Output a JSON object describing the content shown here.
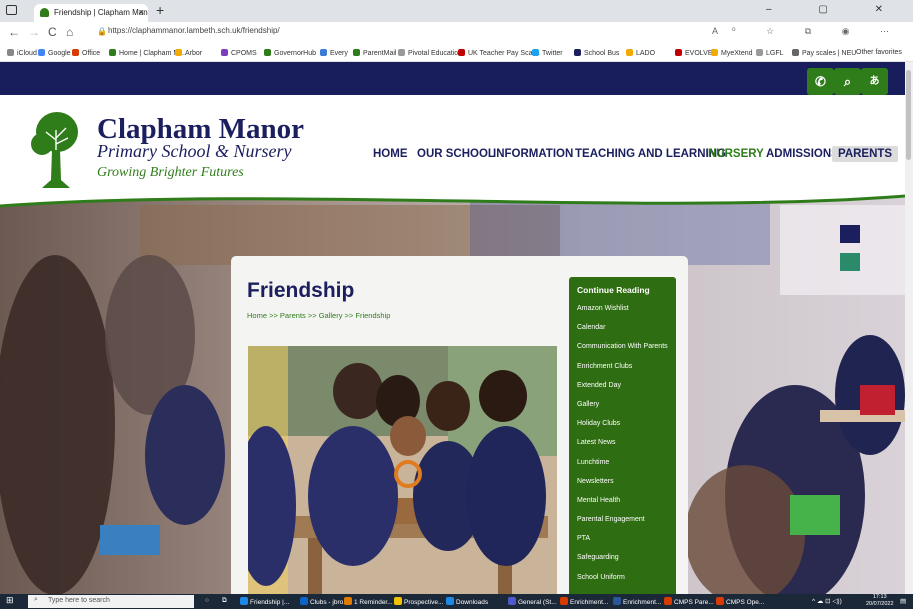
{
  "browser": {
    "tab_title": "Friendship | Clapham Manor Prim",
    "tab_close": "×",
    "new_tab": "+",
    "window_controls": "– ▢ ✕",
    "url": "https://claphammanor.lambeth.sch.uk/friendship/",
    "nav_back": "←",
    "nav_forward": "→",
    "nav_reload": "C",
    "nav_home": "⌂",
    "addr_icons": "A⁰ ☆ ⧉ ◉ ⋯",
    "favorites": [
      {
        "label": "iCloud",
        "color": "#888888"
      },
      {
        "label": "Google",
        "color": "#4285f4"
      },
      {
        "label": "Office",
        "color": "#d83b01"
      },
      {
        "label": "Home | Clapham M...",
        "color": "#2f7d1a"
      },
      {
        "label": "Arbor",
        "color": "#f2a900"
      },
      {
        "label": "CPOMS",
        "color": "#7a3fbf"
      },
      {
        "label": "GovernorHub",
        "color": "#2f7d1a"
      },
      {
        "label": "Every",
        "color": "#3a7bd5"
      },
      {
        "label": "ParentMail",
        "color": "#2f7d1a"
      },
      {
        "label": "Pivotal Education",
        "color": "#999999"
      },
      {
        "label": "UK Teacher Pay Scal...",
        "color": "#c00000"
      },
      {
        "label": "Twitter",
        "color": "#1da1f2"
      },
      {
        "label": "School Bus",
        "color": "#1b1f5e"
      },
      {
        "label": "LADO",
        "color": "#f2a900"
      },
      {
        "label": "EVOLVE",
        "color": "#c00000"
      },
      {
        "label": "MyeXtend",
        "color": "#f2a900"
      },
      {
        "label": "LGFL",
        "color": "#999999"
      },
      {
        "label": "Pay scales | NEU",
        "color": "#666666"
      }
    ],
    "other_favorites": "Other favorites"
  },
  "site": {
    "name": "Clapham Manor",
    "subtitle": "Primary School & Nursery",
    "tagline": "Growing Brighter Futures",
    "top_buttons": [
      {
        "icon": "phone-icon",
        "glyph": "✆"
      },
      {
        "icon": "search-icon",
        "glyph": "⌕"
      },
      {
        "icon": "translate-icon",
        "glyph": "あ"
      }
    ],
    "nav": [
      {
        "label": "HOME"
      },
      {
        "label": "OUR SCHOOL"
      },
      {
        "label": "INFORMATION"
      },
      {
        "label": "TEACHING AND LEARNING"
      },
      {
        "label": "NURSERY"
      },
      {
        "label": "ADMISSIONS"
      },
      {
        "label": "PARENTS"
      }
    ],
    "page_title": "Friendship",
    "breadcrumb": "Home >> Parents >> Gallery >> Friendship",
    "sidebar": {
      "heading": "Continue Reading",
      "items": [
        "Amazon Wishlist",
        "Calendar",
        "Communication With Parents",
        "Enrichment Clubs",
        "Extended Day",
        "Gallery",
        "Holiday Clubs",
        "Latest News",
        "Lunchtime",
        "Newsletters",
        "Mental Health",
        "Parental Engagement",
        "PTA",
        "Safeguarding",
        "School Uniform"
      ]
    },
    "colors": {
      "navy": "#181d5c",
      "green": "#2f7d1a"
    }
  },
  "taskbar": {
    "search_placeholder": "Type here to search",
    "apps": [
      {
        "label": "Friendship |...",
        "color": "#1e88e5"
      },
      {
        "label": "Clubs - jbro...",
        "color": "#0a64c8"
      },
      {
        "label": "1 Reminder...",
        "color": "#e07b00"
      },
      {
        "label": "Prospective...",
        "color": "#f2c200"
      },
      {
        "label": "Downloads",
        "color": "#1e88e5"
      },
      {
        "label": "General (St...",
        "color": "#5059c9"
      },
      {
        "label": "Enrichment...",
        "color": "#d83b01"
      },
      {
        "label": "Enrichment...",
        "color": "#2b579a"
      },
      {
        "label": "CMPS Pare...",
        "color": "#d83b01"
      },
      {
        "label": "CMPS Ope...",
        "color": "#d83b01"
      }
    ],
    "time": "17:13",
    "date": "20/07/2022",
    "tray": "^ ☁ ⊡ ◁))"
  }
}
